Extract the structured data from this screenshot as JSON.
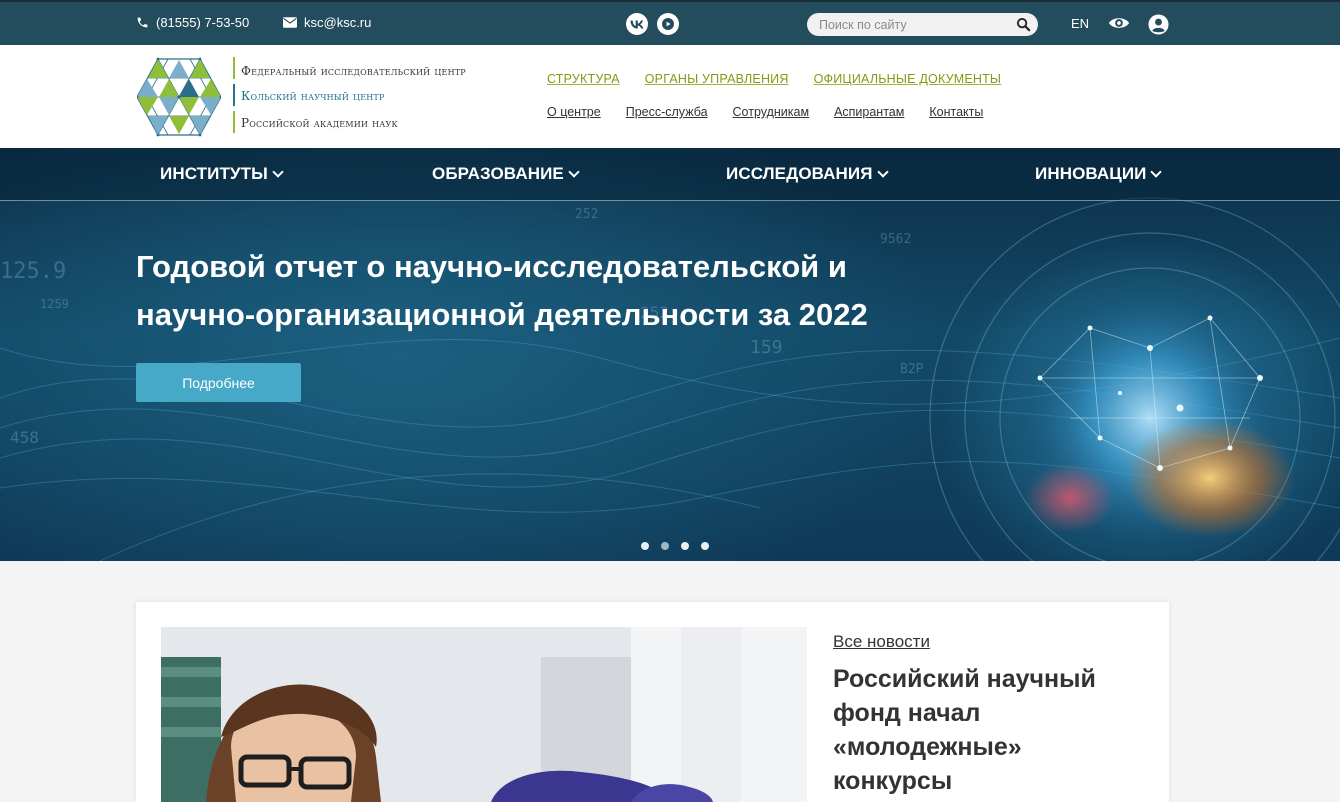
{
  "topbar": {
    "phone": "(81555) 7-53-50",
    "email": "ksc@ksc.ru",
    "search_placeholder": "Поиск по сайту",
    "lang": "EN",
    "icons": [
      "phone-icon",
      "mail-icon",
      "vk-icon",
      "youtube-icon",
      "search-icon",
      "eye-icon",
      "user-icon"
    ]
  },
  "logo": {
    "line1": "Федеральный исследовательский центр",
    "line2": "Кольский научный центр",
    "line3": "Российской академии наук"
  },
  "top_menu": [
    "СТРУКТУРА",
    "ОРГАНЫ УПРАВЛЕНИЯ",
    "ОФИЦИАЛЬНЫЕ ДОКУМЕНТЫ"
  ],
  "sub_menu": [
    "О центре",
    "Пресс-служба",
    "Сотрудникам",
    "Аспирантам",
    "Контакты"
  ],
  "main_nav": [
    "ИНСТИТУТЫ",
    "ОБРАЗОВАНИЕ",
    "ИССЛЕДОВАНИЯ",
    "ИННОВАЦИИ"
  ],
  "hero": {
    "title_line1": "Годовой отчет о научно-исследовательской и",
    "title_line2": "научно-организационной деятельности за 2022",
    "button": "Подробнее",
    "slides_total": 4,
    "active_slide": 1
  },
  "news": {
    "all_news": "Все новости",
    "title": "Российский научный фонд начал «молодежные» конкурсы"
  },
  "colors": {
    "topbar": "#234c5d",
    "accent_green": "#7f9c14",
    "hero_button": "#46a9c8"
  }
}
